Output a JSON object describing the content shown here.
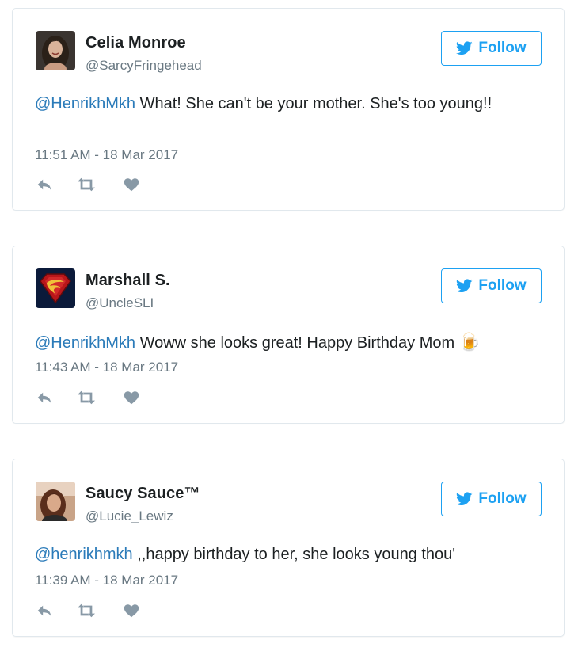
{
  "colors": {
    "accent": "#1da1f2",
    "mention": "#2b7bb9",
    "muted": "#697882",
    "action_icon": "#8899a6",
    "border": "#e1e8ed"
  },
  "tweets": [
    {
      "name": "Celia Monroe",
      "handle": "@SarcyFringehead",
      "mention": "@HenrikhMkh",
      "text": " What! She can't be your mother. She's too young!!",
      "timestamp": "11:51 AM - 18 Mar 2017",
      "follow_label": "Follow",
      "avatar_icon": "woman-portrait-avatar"
    },
    {
      "name": "Marshall S.",
      "handle": "@UncleSLI",
      "mention": "@HenrikhMkh",
      "text": " Woww she looks great! Happy Birthday Mom ",
      "emoji": "🍺",
      "timestamp": "11:43 AM - 18 Mar 2017",
      "follow_label": "Follow",
      "avatar_icon": "superman-shield-avatar"
    },
    {
      "name": "Saucy Sauce™",
      "handle": "@Lucie_Lewiz",
      "mention": "@henrikhmkh",
      "text": " ,,happy birthday to her, she looks young thou'",
      "timestamp": "11:39 AM - 18 Mar 2017",
      "follow_label": "Follow",
      "avatar_icon": "woman-selfie-avatar"
    }
  ]
}
